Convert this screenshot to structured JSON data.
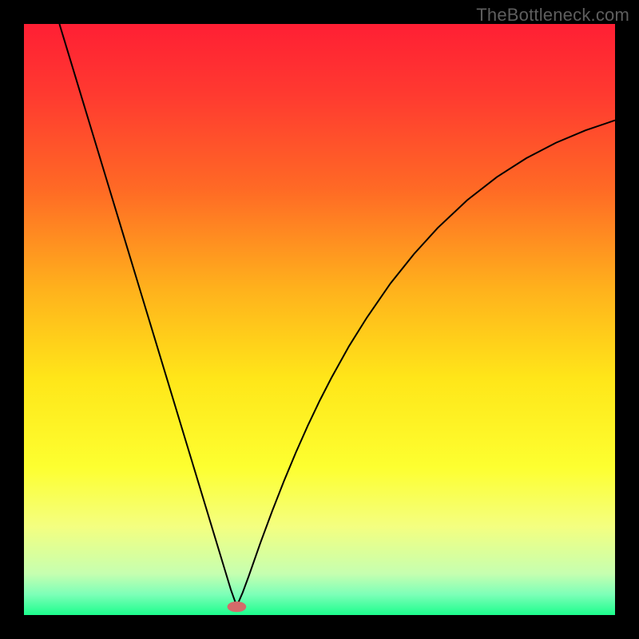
{
  "watermark": "TheBottleneck.com",
  "chart_data": {
    "type": "line",
    "title": "",
    "xlabel": "",
    "ylabel": "",
    "xlim": [
      0,
      100
    ],
    "ylim": [
      0,
      100
    ],
    "minimum_x": 36,
    "background": {
      "stops": [
        {
          "offset": 0.0,
          "color": "#ff1f34"
        },
        {
          "offset": 0.12,
          "color": "#ff3a30"
        },
        {
          "offset": 0.28,
          "color": "#ff6a25"
        },
        {
          "offset": 0.45,
          "color": "#ffb21c"
        },
        {
          "offset": 0.6,
          "color": "#ffe619"
        },
        {
          "offset": 0.75,
          "color": "#fdff30"
        },
        {
          "offset": 0.85,
          "color": "#f4ff80"
        },
        {
          "offset": 0.93,
          "color": "#c6ffb0"
        },
        {
          "offset": 0.965,
          "color": "#7dffb8"
        },
        {
          "offset": 1.0,
          "color": "#1cfd8d"
        }
      ]
    },
    "curve": {
      "comment": "V-shaped bottleneck curve. x is horizontal position in percent of plot width, y is percent (0 = top, 100 = bottom). Minimum sits near x≈36 at y≈100.",
      "x": [
        6,
        8,
        10,
        12,
        14,
        16,
        18,
        20,
        22,
        24,
        26,
        28,
        30,
        32,
        34,
        35,
        36,
        37,
        38,
        40,
        42,
        44,
        46,
        48,
        50,
        52,
        55,
        58,
        62,
        66,
        70,
        75,
        80,
        85,
        90,
        95,
        100
      ],
      "y": [
        0,
        6.6,
        13.2,
        19.8,
        26.4,
        33.0,
        39.6,
        46.2,
        52.8,
        59.4,
        66.0,
        72.6,
        79.2,
        85.8,
        92.4,
        95.7,
        98.5,
        96.2,
        93.5,
        87.8,
        82.4,
        77.3,
        72.5,
        68.0,
        63.8,
        59.9,
        54.5,
        49.7,
        43.9,
        38.9,
        34.5,
        29.8,
        25.9,
        22.7,
        20.1,
        18.0,
        16.3
      ]
    },
    "marker": {
      "cx": 36,
      "cy": 98.6,
      "rx": 1.6,
      "ry": 0.9,
      "fill": "#d46a6a"
    }
  }
}
